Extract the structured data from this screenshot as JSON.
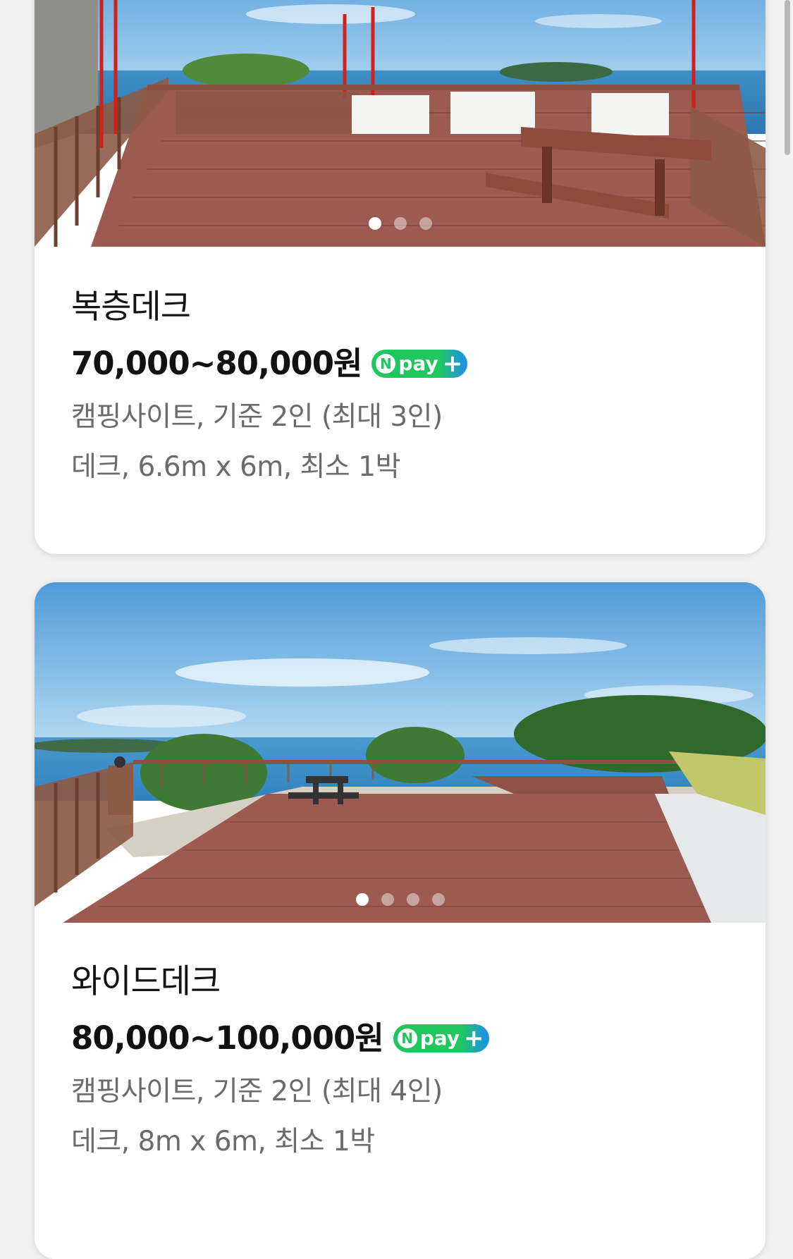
{
  "listings": [
    {
      "title": "복층데크",
      "price": "70,000~80,000원",
      "badge": {
        "n": "N",
        "label": "pay",
        "plus": "+"
      },
      "info_line1": "캠핑사이트, 기준 2인 (최대 3인)",
      "info_line2": "데크, 6.6m x 6m, 최소 1박",
      "carousel": {
        "count": 3,
        "active_index": 0
      }
    },
    {
      "title": "와이드데크",
      "price": "80,000~100,000원",
      "badge": {
        "n": "N",
        "label": "pay",
        "plus": "+"
      },
      "info_line1": "캠핑사이트, 기준 2인 (최대 4인)",
      "info_line2": "데크, 8m x 6m, 최소 1박",
      "carousel": {
        "count": 4,
        "active_index": 0
      }
    }
  ],
  "colors": {
    "npay_green": "#1fc85c",
    "npay_blue": "#1c8ef2",
    "deck": "#9c5a50",
    "sky": "#5ea8dc"
  }
}
